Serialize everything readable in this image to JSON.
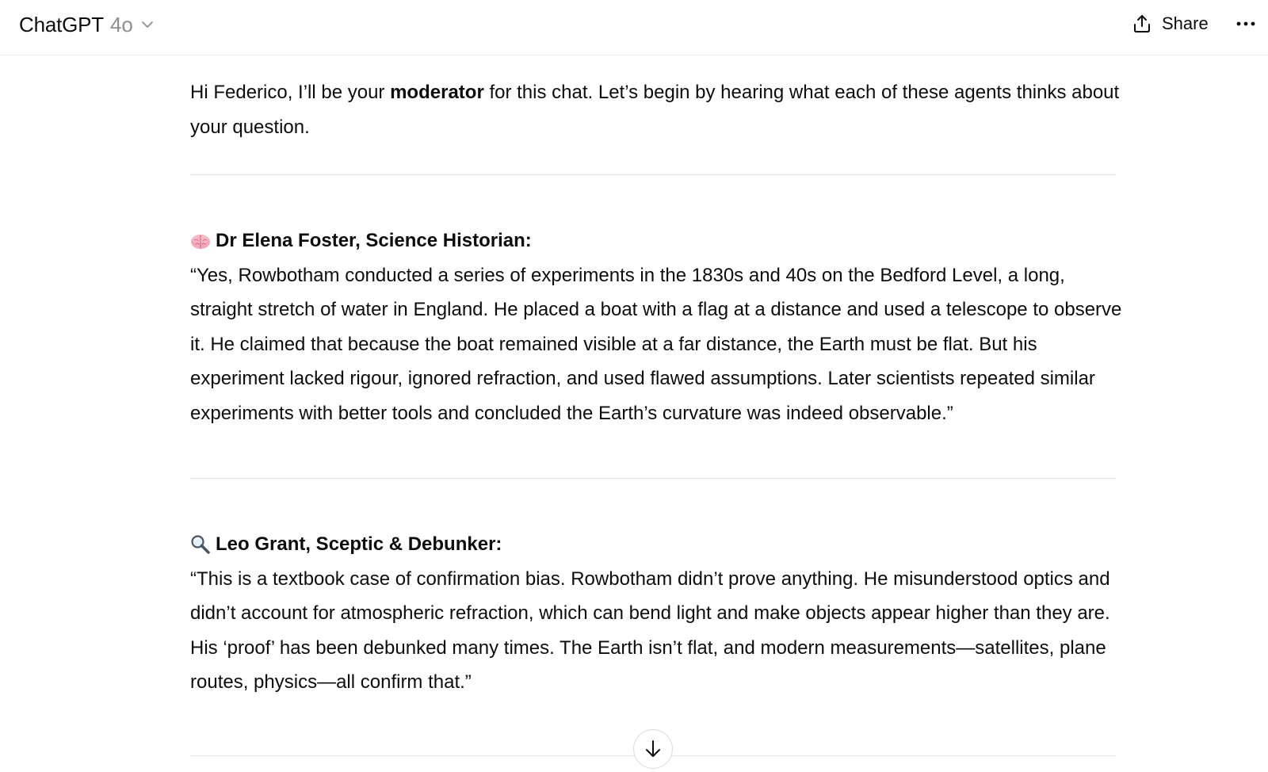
{
  "header": {
    "app_name": "ChatGPT",
    "model_name": "4o",
    "share_label": "Share"
  },
  "icons": {
    "model_dropdown": "chevron-down-icon",
    "share": "share-upload-icon",
    "more": "more-horizontal-icon",
    "scroll_down": "arrow-down-icon",
    "agent1_emoji": "brain-emoji",
    "agent2_emoji": "magnifying-glass-emoji"
  },
  "message": {
    "intro_before": "Hi Federico, I’ll be your ",
    "intro_bold": "moderator",
    "intro_after": " for this chat. Let’s begin by hearing what each of these agents thinks about your question.",
    "agents": [
      {
        "heading": "Dr Elena Foster, Science Historian:",
        "quote": "“Yes, Rowbotham conducted a series of experiments in the 1830s and 40s on the Bedford Level, a long, straight stretch of water in England. He placed a boat with a flag at a distance and used a telescope to observe it. He claimed that because the boat remained visible at a far distance, the Earth must be flat. But his experiment lacked rigour, ignored refraction, and used flawed assumptions. Later scientists repeated similar experiments with better tools and concluded the Earth’s curvature was indeed observable.”"
      },
      {
        "heading": "Leo Grant, Sceptic & Debunker:",
        "quote": "“This is a textbook case of confirmation bias. Rowbotham didn’t prove anything. He misunderstood optics and didn’t account for atmospheric refraction, which can bend light and make objects appear higher than they are. His ‘proof’ has been debunked many times. The Earth isn’t flat, and modern measurements—satellites, plane routes, physics—all confirm that.”"
      }
    ]
  },
  "colors": {
    "text": "#0d0d0d",
    "muted": "#8f8f8f",
    "divider": "#e6e6e6",
    "background": "#ffffff"
  }
}
